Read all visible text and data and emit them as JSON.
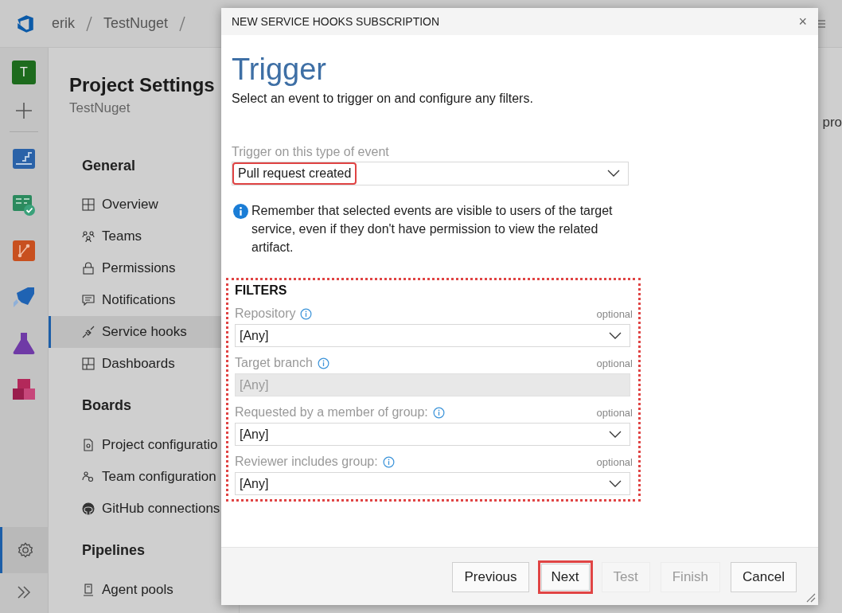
{
  "top_bar": {
    "breadcrumb": [
      "erik",
      "TestNuget"
    ]
  },
  "rail": {
    "avatar": "T",
    "settings_selected": true
  },
  "sidebar": {
    "title": "Project Settings",
    "subtitle": "TestNuget",
    "groups": [
      {
        "heading": "General",
        "items": [
          {
            "label": "Overview",
            "selected": false
          },
          {
            "label": "Teams",
            "selected": false
          },
          {
            "label": "Permissions",
            "selected": false
          },
          {
            "label": "Notifications",
            "selected": false
          },
          {
            "label": "Service hooks",
            "selected": true
          },
          {
            "label": "Dashboards",
            "selected": false
          }
        ]
      },
      {
        "heading": "Boards",
        "items": [
          {
            "label": "Project configuratio",
            "selected": false
          },
          {
            "label": "Team configuration",
            "selected": false
          },
          {
            "label": "GitHub connections",
            "selected": false
          }
        ]
      },
      {
        "heading": "Pipelines",
        "items": [
          {
            "label": "Agent pools",
            "selected": false
          }
        ]
      }
    ]
  },
  "main_fragment": "pro",
  "dialog": {
    "title": "NEW SERVICE HOOKS SUBSCRIPTION",
    "close": "×",
    "heading": "Trigger",
    "description": "Select an event to trigger on and configure any filters.",
    "event": {
      "label": "Trigger on this type of event",
      "value": "Pull request created",
      "highlighted": true
    },
    "note": "Remember that selected events are visible to users of the target service, even if they don't have permission to view the related artifact.",
    "filters": {
      "heading": "FILTERS",
      "highlighted": true,
      "fields": [
        {
          "label": "Repository",
          "optional": "optional",
          "value": "[Any]",
          "disabled": false
        },
        {
          "label": "Target branch",
          "optional": "optional",
          "value": "[Any]",
          "disabled": true
        },
        {
          "label": "Requested by a member of group:",
          "optional": "optional",
          "value": "[Any]",
          "disabled": false
        },
        {
          "label": "Reviewer includes group:",
          "optional": "optional",
          "value": "[Any]",
          "disabled": false
        }
      ]
    },
    "buttons": [
      {
        "label": "Previous",
        "disabled": false,
        "highlighted": false
      },
      {
        "label": "Next",
        "disabled": false,
        "highlighted": true
      },
      {
        "label": "Test",
        "disabled": true,
        "highlighted": false
      },
      {
        "label": "Finish",
        "disabled": true,
        "highlighted": false
      },
      {
        "label": "Cancel",
        "disabled": false,
        "highlighted": false
      }
    ]
  }
}
